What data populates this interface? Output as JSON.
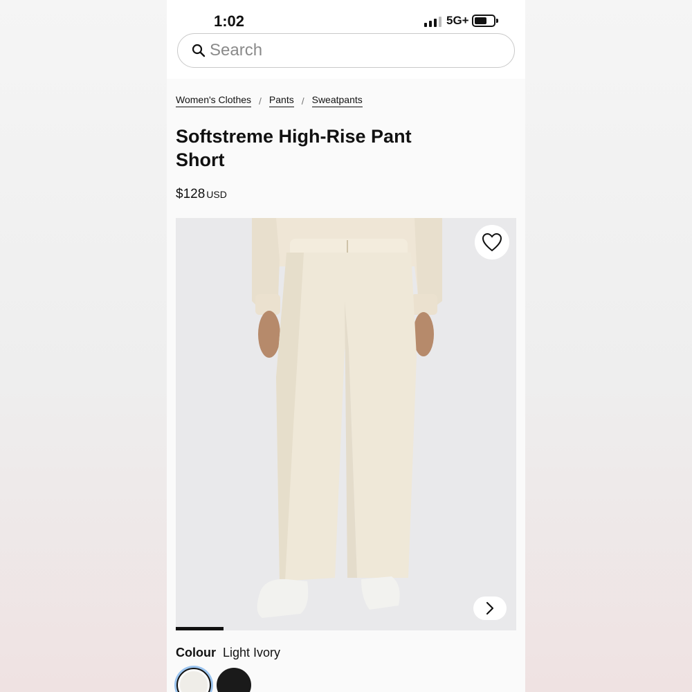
{
  "status_bar": {
    "time": "1:02",
    "network": "5G+",
    "signal_bars_active": 3,
    "signal_bars_total": 4,
    "battery_level": 0.65
  },
  "search": {
    "placeholder": "Search",
    "value": ""
  },
  "breadcrumb": {
    "items": [
      "Women's Clothes",
      "Pants",
      "Sweatpants"
    ],
    "separator": "/"
  },
  "product": {
    "title": "Softstreme High-Rise Pant Short",
    "price": "$128",
    "currency": "USD",
    "gallery": {
      "current_image": 1,
      "progress": 0.14
    },
    "colour": {
      "label": "Colour",
      "selected_name": "Light Ivory",
      "swatches": [
        {
          "name": "Light Ivory",
          "color": "#efede8",
          "selected": true
        },
        {
          "name": "Black",
          "color": "#1a1a1a",
          "selected": false
        }
      ]
    }
  },
  "colors": {
    "accent_ring": "#9bc4ef",
    "text": "#111111",
    "image_bg": "#e9e9eb",
    "pant_color": "#efe8d8"
  }
}
